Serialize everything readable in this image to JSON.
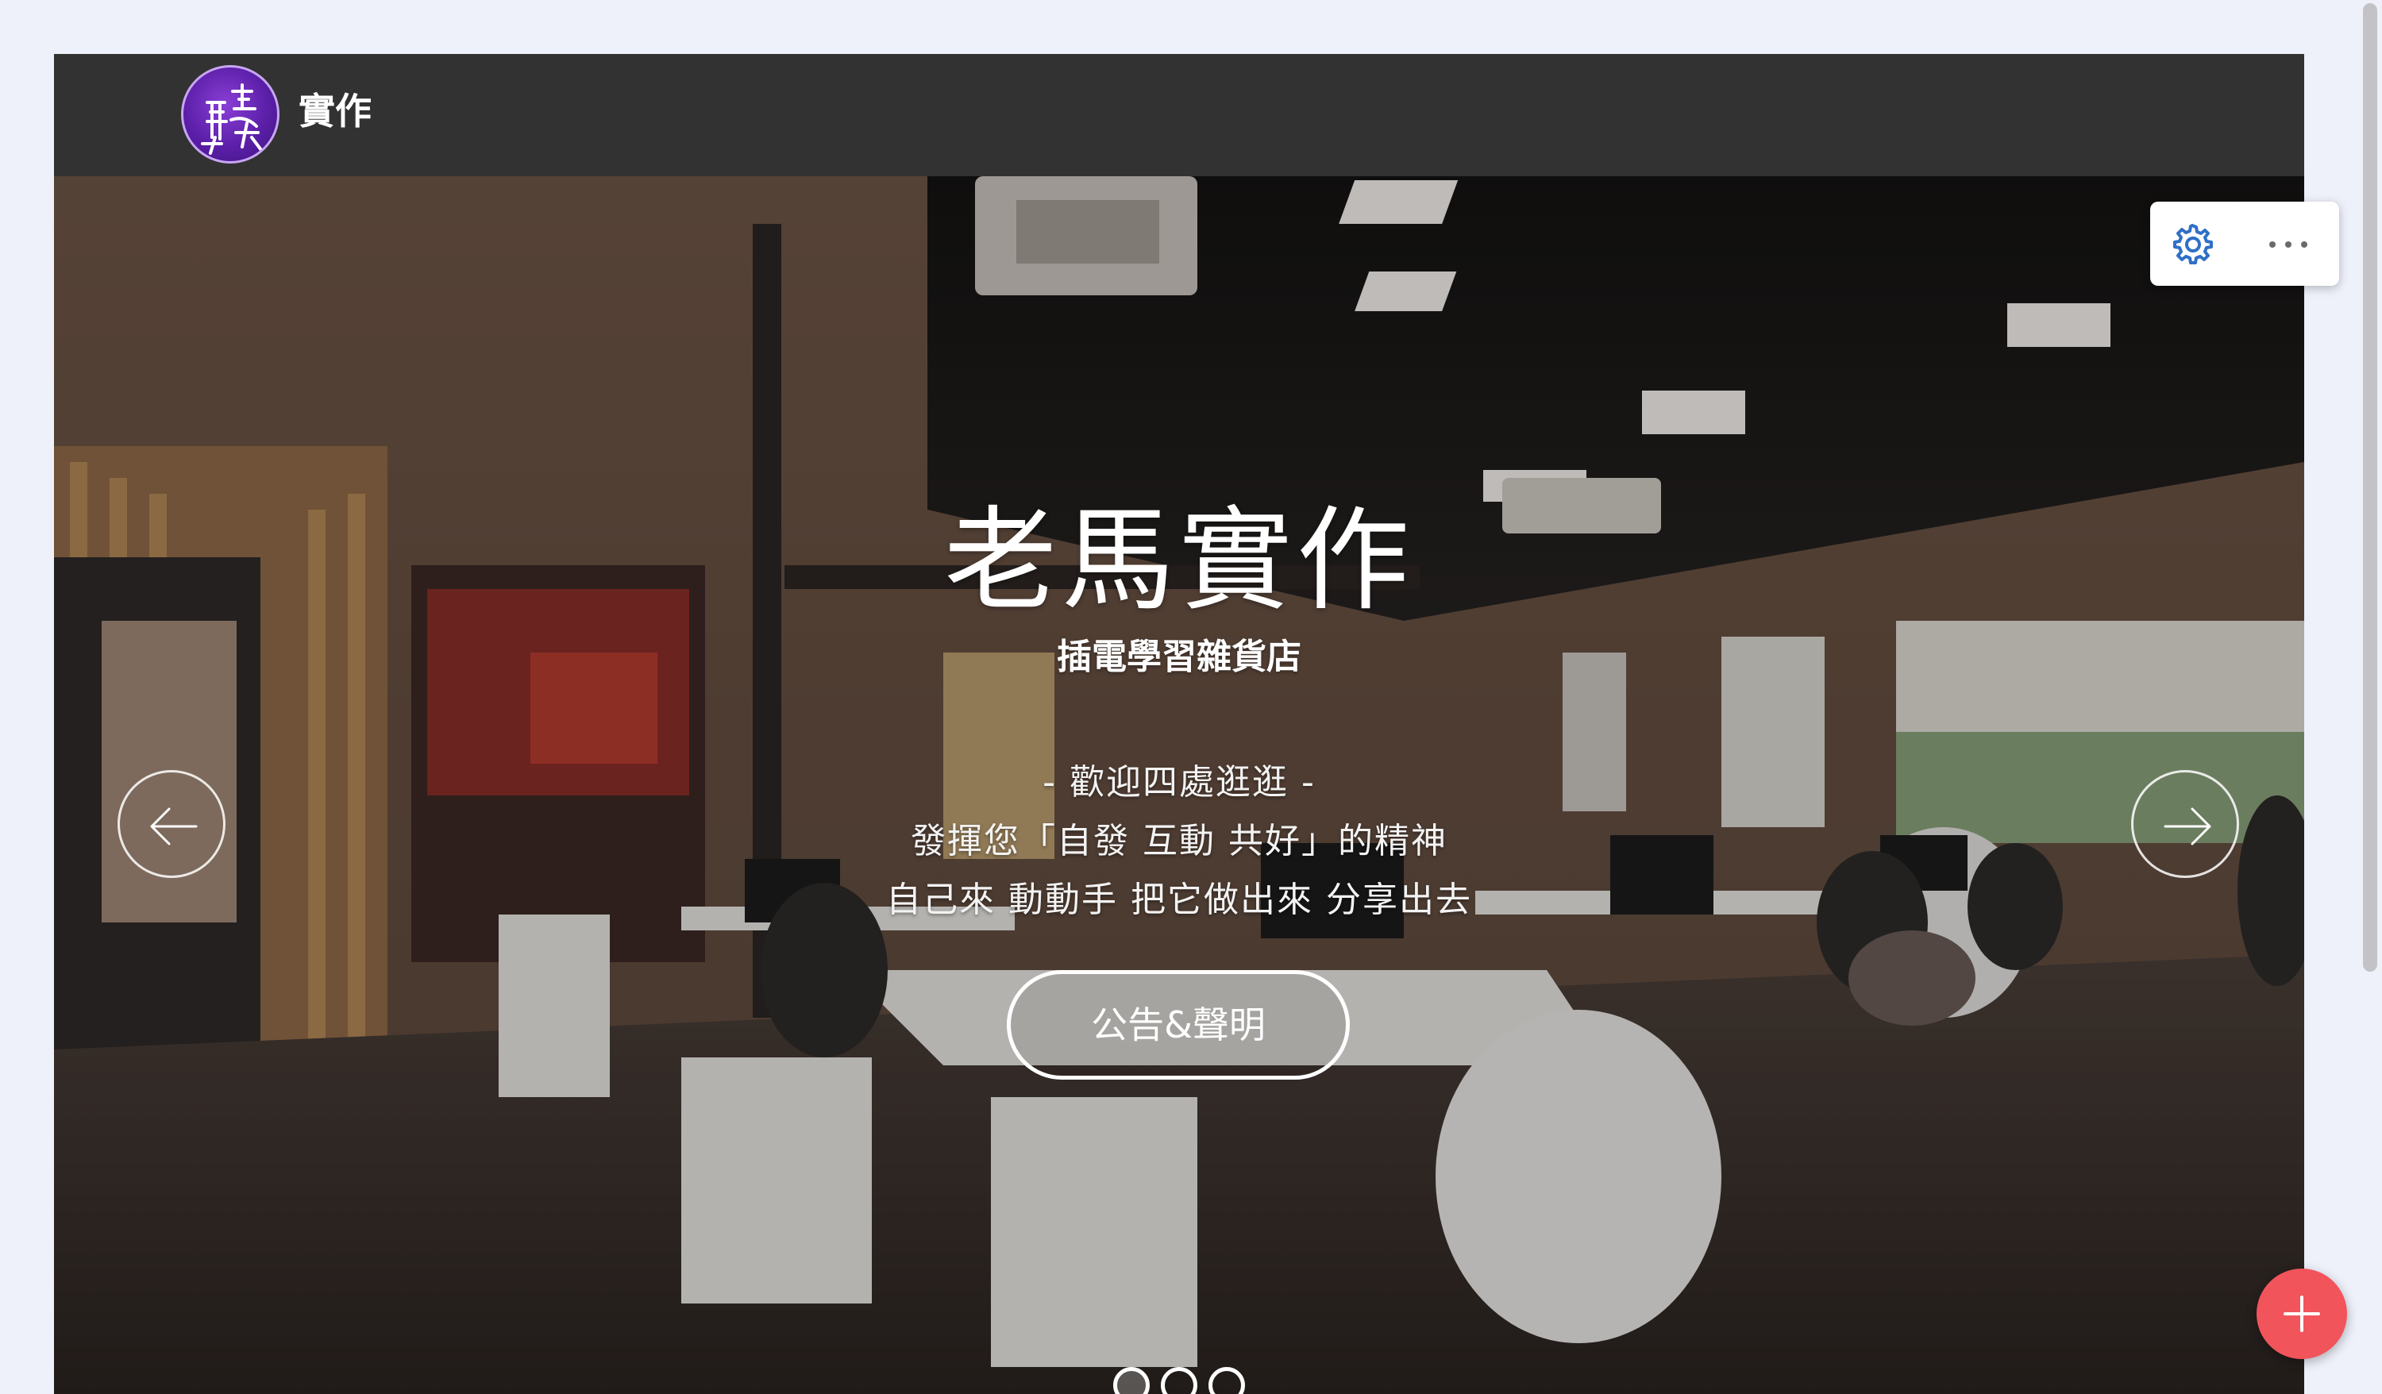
{
  "header": {
    "site_title": "實作",
    "logo_icon": "site-logo-icon"
  },
  "hero": {
    "title": "老馬實作",
    "subtitle": "插電學習雜貨店",
    "lines": [
      "- 歡迎四處逛逛 -",
      "發揮您「自發 互動 共好」的精神",
      "自己來 動動手 把它做出來 分享出去"
    ],
    "button_label": "公告&聲明",
    "carousel": {
      "prev_icon": "chevron-left-icon",
      "next_icon": "chevron-right-icon",
      "slide_count": 3,
      "active_index": 0
    }
  },
  "toolbar": {
    "settings_icon": "gear-icon",
    "more_icon": "more-horizontal-icon"
  },
  "fab": {
    "icon": "plus-icon"
  },
  "colors": {
    "header_bg": "#323232",
    "page_bg": "#eef0fa",
    "fab": "#f2545b",
    "accent_gear": "#2f6fc7",
    "logo_purple": "#6a2bbd"
  }
}
